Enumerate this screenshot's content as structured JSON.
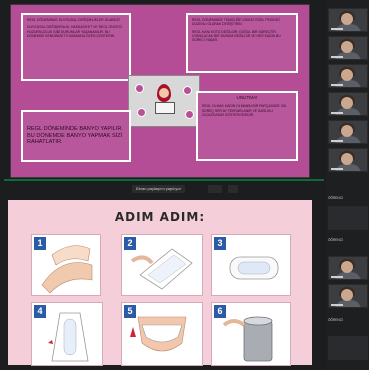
{
  "slide1": {
    "card_top_left": {
      "p1": "REGL DÖNEMİNDE DUYGUSAL DEĞİŞİKLİKLER OLABİLİR.",
      "p2": "DUYGUSAL DEĞİŞKENLİK, HASSASİYET VE REGL ÖNCESİ HUZURSUZLUK GİBİ DURUMLAR YAŞANABİLİR. BU DÖNEMDE KENDİNİZE İYİ BAKMAYA ÖZEN GÖSTERİN."
    },
    "card_top_right": {
      "p1": "REGL DÖNEMİNDE TEMİZLİĞE DİKKAT EDİN, PEDİNİZİ DÜZENLİ OLARAK DEĞİŞTİRİN.",
      "p2": "REGL KANI KÖTÜ DEĞİLDİR, DOĞAL BİR SÜREÇTİR. UTANILACAK BİR DURUM DEĞİLDİR VE HER KADIN BU SÜRECİ YAŞAR."
    },
    "card_bottom_left": "REGL DÖNEMİNDE BANYO YAPILIR. BU DÖNEMDE BANYO YAPMAK SİZİ RAHATLATIR.",
    "card_bottom_right": {
      "heading": "UNUTMA!",
      "p1": "REGL OLMAK KADIN OLMANIN BİR PARÇASIDIR. BU SÜREÇ HER AY TEKRARLANIR VE SAĞLIKLI OLDUĞUNUN GÖSTERGESİDİR."
    }
  },
  "screen_share_banner": "Ekran paylaşımı yapılıyor",
  "slide2": {
    "title": "ADIM ADIM:",
    "steps": [
      "1",
      "2",
      "3",
      "4",
      "5",
      "6"
    ]
  },
  "sidebar": {
    "label_a": "ÖĞRENCİ",
    "label_b": "ÖĞRENCİ",
    "label_c": "ÖĞRENCİ"
  }
}
